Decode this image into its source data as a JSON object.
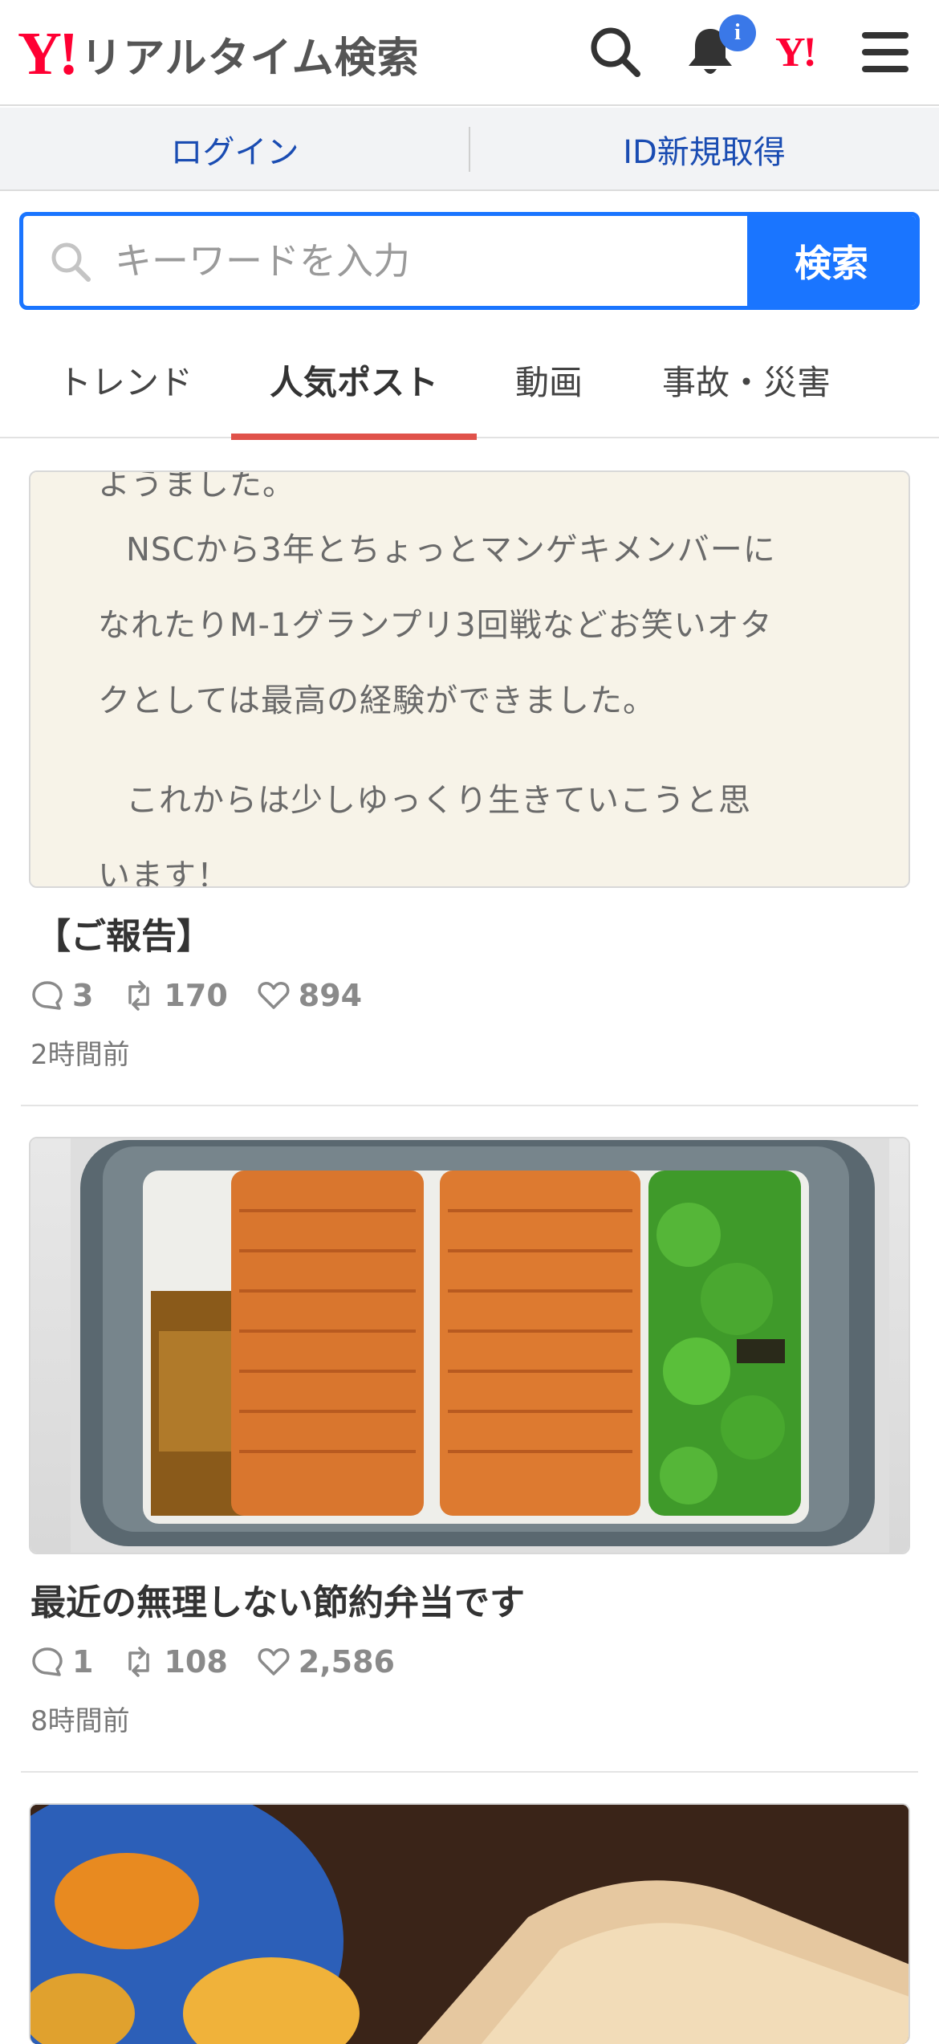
{
  "header": {
    "logo_mark": "Y!",
    "logo_text": "リアルタイム検索",
    "notification_badge": "i",
    "yahoo_japan_mark": "Y!"
  },
  "account": {
    "login_label": "ログイン",
    "signup_label": "ID新規取得"
  },
  "search": {
    "placeholder": "キーワードを入力",
    "value": "",
    "button_label": "検索"
  },
  "tabs": [
    {
      "label": "トレンド",
      "active": false
    },
    {
      "label": "人気ポスト",
      "active": true
    },
    {
      "label": "動画",
      "active": false
    },
    {
      "label": "事故・災害",
      "active": false
    }
  ],
  "posts": [
    {
      "image_text": [
        "ようました。",
        "　NSCから3年とちょっとマンゲキメンバーに",
        "なれたりM-1グランプリ3回戦などお笑いオタ",
        "クとしては最高の経験ができました。",
        "　これからは少しゆっくり生きていこうと思",
        "います！"
      ],
      "title": "【ご報告】",
      "replies": "3",
      "reposts": "170",
      "likes": "894",
      "time": "2時間前"
    },
    {
      "title": "最近の無理しない節約弁当です",
      "replies": "1",
      "reposts": "108",
      "likes": "2,586",
      "time": "8時間前"
    },
    {}
  ],
  "colors": {
    "accent_blue": "#1a75ff",
    "tab_underline": "#e0524a",
    "brand_red": "#ff0033",
    "link_blue": "#1a4cb2"
  }
}
